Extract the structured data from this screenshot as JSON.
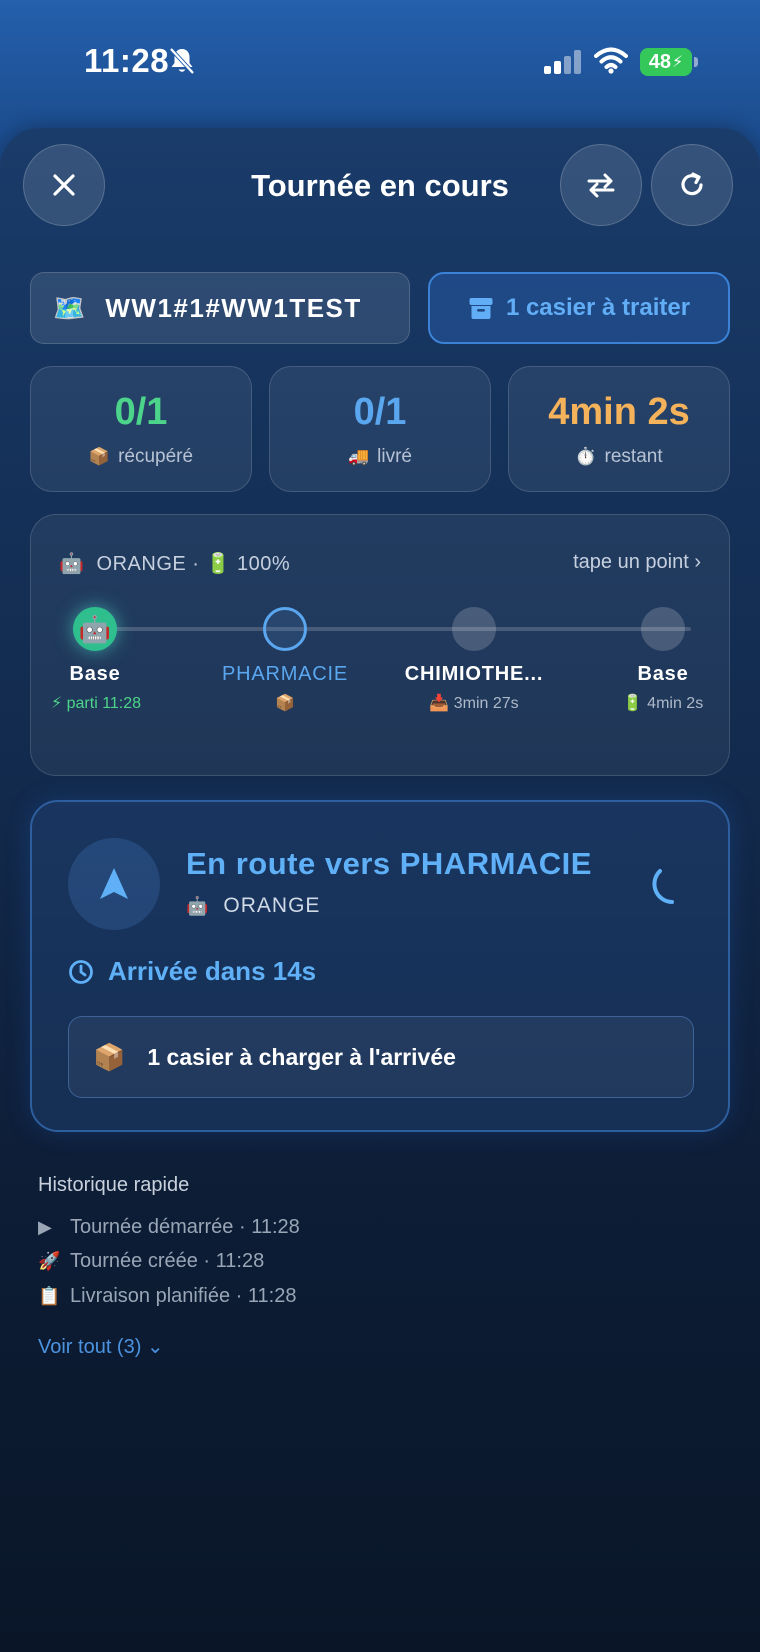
{
  "status_bar": {
    "time": "11:28",
    "battery": "48"
  },
  "header": {
    "title": "Tournée en cours",
    "close_icon": "close-icon",
    "swap_icon": "swap-arrows-icon",
    "refresh_icon": "refresh-icon"
  },
  "route": {
    "emoji": "🗺️",
    "code": "WW1#1#WW1TEST",
    "casier_label": "1 casier à traiter"
  },
  "stats": [
    {
      "value": "0/1",
      "emoji": "📦",
      "label": "récupéré",
      "color": "#4cd58a"
    },
    {
      "value": "0/1",
      "emoji": "🚚",
      "label": "livré",
      "color": "#5aa7f0"
    },
    {
      "value": "4min 2s",
      "emoji": "⏱️",
      "label": "restant",
      "color": "#f4b25b"
    }
  ],
  "timeline": {
    "robot_emoji": "🤖",
    "robot": "ORANGE · 🔋 100%",
    "hint": "tape un point ›",
    "stops": [
      {
        "name": "Base",
        "sub": "⚡ parti 11:28",
        "state": "done"
      },
      {
        "name": "PHARMACIE",
        "sub": "📦",
        "state": "current"
      },
      {
        "name": "CHIMIOTHE...",
        "sub": "📥 3min 27s",
        "state": "future"
      },
      {
        "name": "Base",
        "sub": "🔋 4min 2s",
        "state": "future"
      }
    ]
  },
  "active": {
    "title": "En route vers PHARMACIE",
    "robot_emoji": "🤖",
    "robot": "ORANGE",
    "eta": "Arrivée dans 14s",
    "load_emoji": "📦",
    "load": "1 casier à charger à l'arrivée"
  },
  "history": {
    "title": "Historique rapide",
    "items": [
      {
        "emoji": "▶",
        "text": "Tournée démarrée · 11:28"
      },
      {
        "emoji": "🚀",
        "text": "Tournée créée · 11:28"
      },
      {
        "emoji": "📋",
        "text": "Livraison planifiée · 11:28"
      }
    ],
    "more": "Voir tout (3) ⌄"
  },
  "colors": {
    "accent": "#5fb0f6",
    "green": "#4cd58a",
    "orange": "#f4b25b"
  }
}
